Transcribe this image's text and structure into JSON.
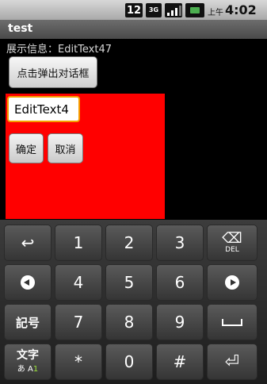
{
  "status_bar": {
    "notification_count": "12",
    "network_type_top": "3G",
    "network_type_bottom": "",
    "ampm": "上午",
    "time": "4:02",
    "battery_color": "#4caf50"
  },
  "title_bar": {
    "title": "test"
  },
  "info": {
    "text": "展示信息：EditText47"
  },
  "popup_button": {
    "label": "点击弹出对话框"
  },
  "dialog": {
    "background": "#ff0000",
    "input_value": "EditText4",
    "ok_label": "确定",
    "cancel_label": "取消"
  },
  "keyboard": {
    "row1": {
      "back_icon": "↩",
      "k1": "1",
      "k2": "2",
      "k3": "3",
      "del_icon": "⌫",
      "del_label": "DEL"
    },
    "row2": {
      "k4": "4",
      "k5": "5",
      "k6": "6"
    },
    "row3": {
      "symbols_label": "記号",
      "k7": "7",
      "k8": "8",
      "k9": "9"
    },
    "row4": {
      "mode_label": "文字",
      "mode_sub_a": "あ A",
      "mode_sub_1": "1",
      "star": "*",
      "k0": "0",
      "hash": "#",
      "enter_icon": "⏎"
    }
  }
}
